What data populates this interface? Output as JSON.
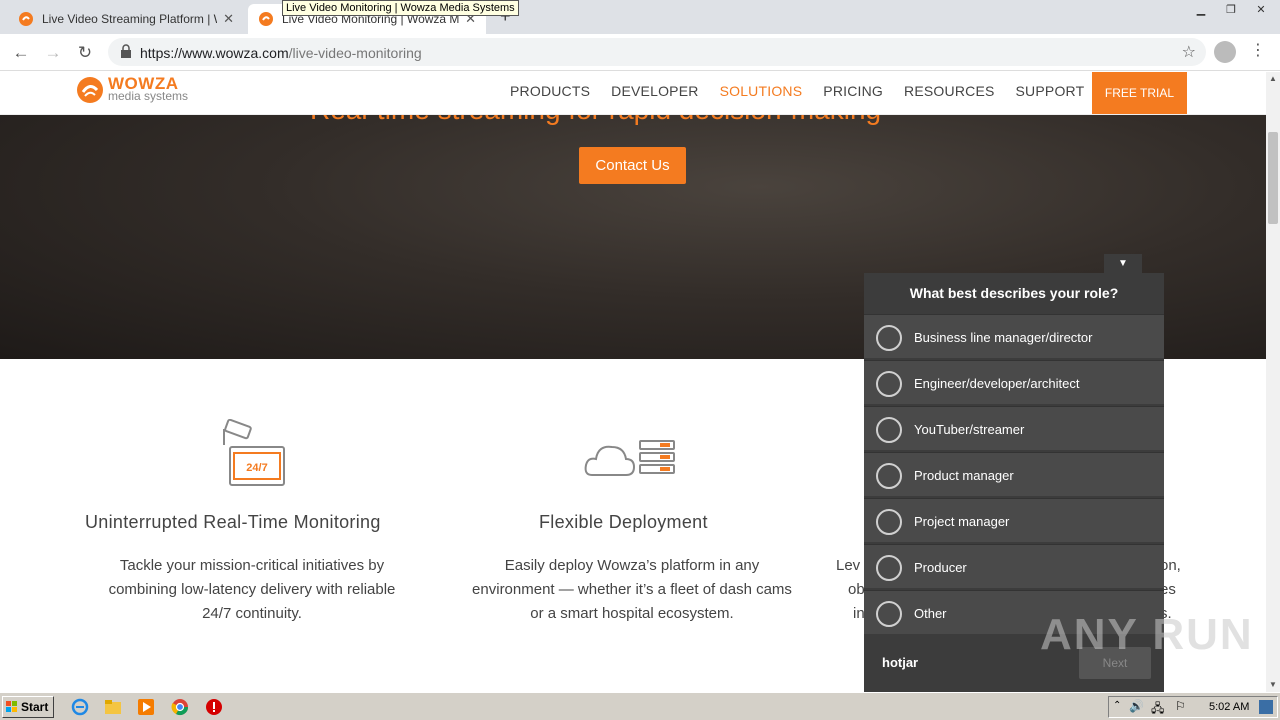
{
  "browser": {
    "tabs": [
      {
        "title": "Live Video Streaming Platform | Wow"
      },
      {
        "title": "Live Video Monitoring | Wowza Medi"
      }
    ],
    "tooltip": "Live Video Monitoring | Wowza Media Systems",
    "url_host": "https://www.wowza.com",
    "url_path": "/live-video-monitoring"
  },
  "site": {
    "logo_main": "WOWZA",
    "logo_sub": "media systems",
    "nav": [
      "PRODUCTS",
      "DEVELOPER",
      "SOLUTIONS",
      "PRICING",
      "RESOURCES",
      "SUPPORT"
    ],
    "active_nav": "SOLUTIONS",
    "free_trial": "FREE TRIAL",
    "accent": "#f47b20"
  },
  "hero": {
    "heading": "Real-time streaming for rapid decision-making",
    "cta": "Contact Us"
  },
  "features": [
    {
      "title": "Uninterrupted Real-Time Monitoring",
      "desc_lines": [
        "Tackle your mission-critical initiatives by",
        "combining low-latency delivery with reliable",
        "24/7 continuity."
      ]
    },
    {
      "title": "Flexible Deployment",
      "desc_lines": [
        "Easily deploy Wowza’s platform in any",
        "environment — whether it’s a fleet of dash cams",
        "or a smart hospital ecosystem."
      ]
    },
    {
      "desc_lines": [
        "Lev",
        "ob",
        "in"
      ],
      "partial_right": [
        "on,",
        "es",
        "s."
      ]
    }
  ],
  "survey": {
    "question": "What best describes your role?",
    "options": [
      "Business line manager/director",
      "Engineer/developer/architect",
      "YouTuber/streamer",
      "Product manager",
      "Project manager",
      "Producer",
      "Other"
    ],
    "brand": "hotjar",
    "next": "Next"
  },
  "watermark": "ANY RUN",
  "taskbar": {
    "start": "Start",
    "time": "5:02 AM"
  }
}
